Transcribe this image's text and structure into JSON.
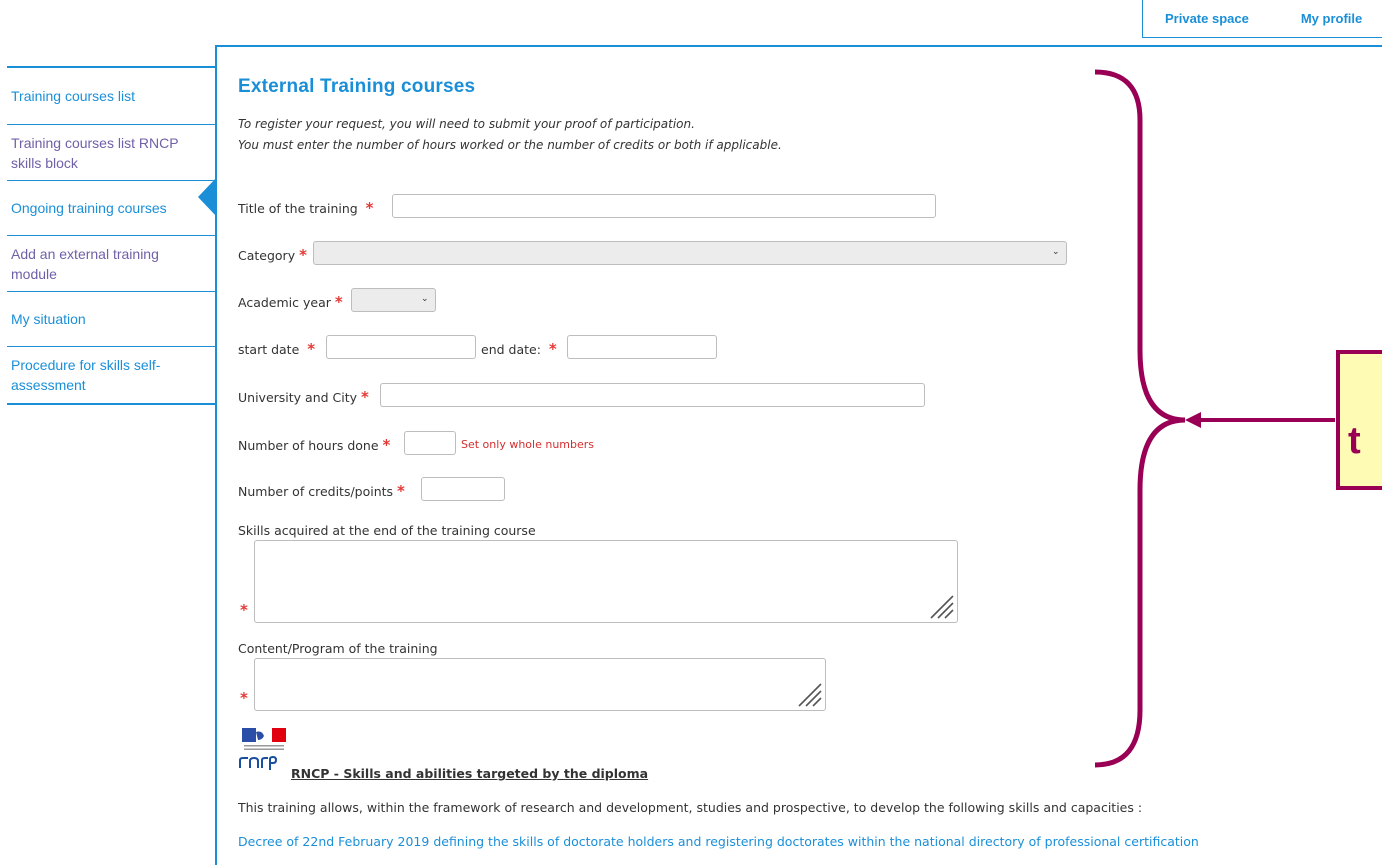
{
  "header": {
    "tabs": [
      {
        "label": "Private space"
      },
      {
        "label": "My profile"
      }
    ]
  },
  "sidebar": {
    "items": [
      {
        "label": "Training courses list"
      },
      {
        "label": "Training courses list RNCP skills block"
      },
      {
        "label": "Ongoing training courses"
      },
      {
        "label": "Add an external training module"
      },
      {
        "label": "My situation"
      },
      {
        "label": "Procedure for skills self-assessment"
      }
    ]
  },
  "main": {
    "title": "External Training courses",
    "intro_line1": "To register your request, you will need to submit your proof of participation.",
    "intro_line2": "You must enter the number of hours worked or the number of credits or both if applicable.",
    "form": {
      "required_mark": "*",
      "title_label": "Title of the training",
      "title_value": "",
      "category_label": "Category",
      "category_value": "",
      "academic_year_label": "Academic year",
      "academic_year_value": "",
      "start_date_label": "start date",
      "start_date_value": "",
      "end_date_label": "end date:",
      "end_date_value": "",
      "university_label": "University and City",
      "university_value": "",
      "hours_label": "Number of hours done",
      "hours_value": "",
      "hours_hint": "Set only whole numbers",
      "credits_label": "Number of credits/points",
      "credits_value": "",
      "skills_label": "Skills acquired at the end of the training course",
      "content_label": "Content/Program of the training"
    },
    "rncp": {
      "title": "RNCP - Skills and abilities targeted by the diploma",
      "description": "This training allows, within the framework of research and development, studies and prospective, to develop the following skills and capacities :",
      "decree_link": "Decree of 22nd February 2019 defining the skills of doctorate holders and registering doctorates within the national directory of professional certification"
    }
  },
  "annotation": {
    "callout_text": "t",
    "color": "#990055",
    "fill": "#fdfbb4"
  },
  "colors": {
    "accent": "#1a8fd8",
    "required": "#e53935",
    "visited": "#7060a8"
  }
}
